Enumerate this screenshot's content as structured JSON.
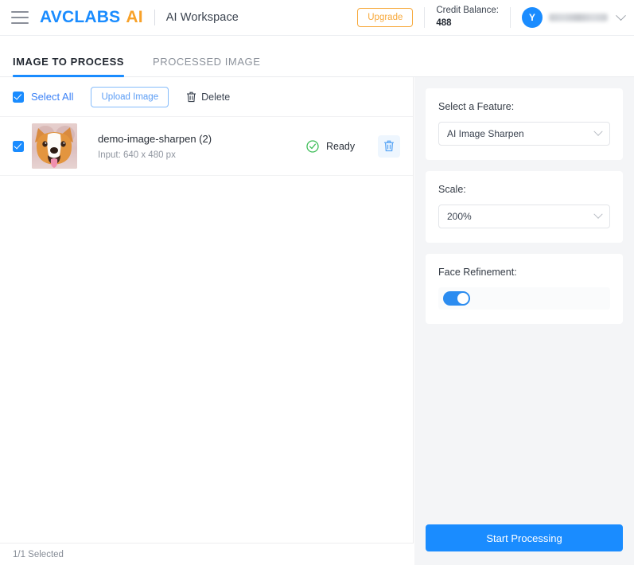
{
  "header": {
    "menu_icon": "hamburger-menu-icon",
    "brand_primary": "AVCLABS",
    "brand_accent": "AI",
    "workspace_title": "AI Workspace",
    "upgrade_label": "Upgrade",
    "credit_label": "Credit Balance:",
    "credit_value": "488",
    "avatar_initial": "Y",
    "user_name": "",
    "chevron_icon": "chevron-down-icon",
    "brand_blue": "#1a8cff",
    "brand_orange": "#f8a128"
  },
  "tabs": [
    {
      "label": "IMAGE TO PROCESS",
      "active": true
    },
    {
      "label": "PROCESSED IMAGE",
      "active": false
    }
  ],
  "toolbar": {
    "select_all_label": "Select All",
    "select_all_checked": true,
    "upload_label": "Upload Image",
    "delete_label": "Delete",
    "delete_icon": "trash-icon"
  },
  "files": [
    {
      "checked": true,
      "thumbnail_alt": "corgi-dog-photo",
      "name": "demo-image-sharpen (2)",
      "info": "Input: 640 x 480 px",
      "status": "Ready",
      "status_icon": "check-circle-icon",
      "status_color": "#3dbd57",
      "row_delete_icon": "trash-icon"
    }
  ],
  "footer": {
    "selection_text": "1/1 Selected"
  },
  "settings": {
    "feature": {
      "label": "Select a Feature:",
      "value": "AI Image Sharpen"
    },
    "scale": {
      "label": "Scale:",
      "value": "200%"
    },
    "face_refinement": {
      "label": "Face Refinement:",
      "enabled": true
    }
  },
  "actions": {
    "start_processing_label": "Start Processing",
    "start_processing_color": "#1a8cff"
  }
}
